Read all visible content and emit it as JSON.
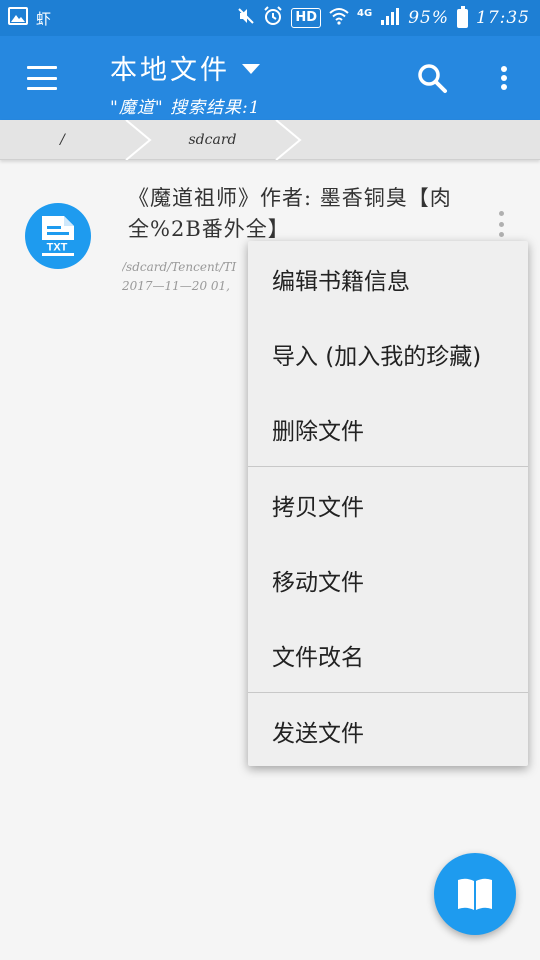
{
  "status_bar": {
    "carrier_glyph": "虾",
    "hd_badge": "HD",
    "network_type": "4G",
    "battery": "95%",
    "time": "17:35"
  },
  "app_bar": {
    "title": "本地文件",
    "subtitle": "\"魔道\" 搜索结果:1"
  },
  "breadcrumb": {
    "items": [
      {
        "label": "/"
      },
      {
        "label": "sdcard"
      }
    ]
  },
  "file": {
    "icon_label": "TXT",
    "title": "《魔道祖师》作者: 墨香铜臭【肉全%2B番外全】",
    "path": "/sdcard/Tencent/TI",
    "date": "2017—11—20 01,"
  },
  "context_menu": {
    "items": [
      {
        "label": "编辑书籍信息"
      },
      {
        "label": "导入 (加入我的珍藏)"
      },
      {
        "label": "删除文件"
      },
      {
        "label": "拷贝文件"
      },
      {
        "label": "移动文件"
      },
      {
        "label": "文件改名"
      },
      {
        "label": "发送文件"
      }
    ]
  },
  "colors": {
    "status_bar": "#1e7fd4",
    "app_bar": "#2688e0",
    "accent": "#1e9bef"
  }
}
